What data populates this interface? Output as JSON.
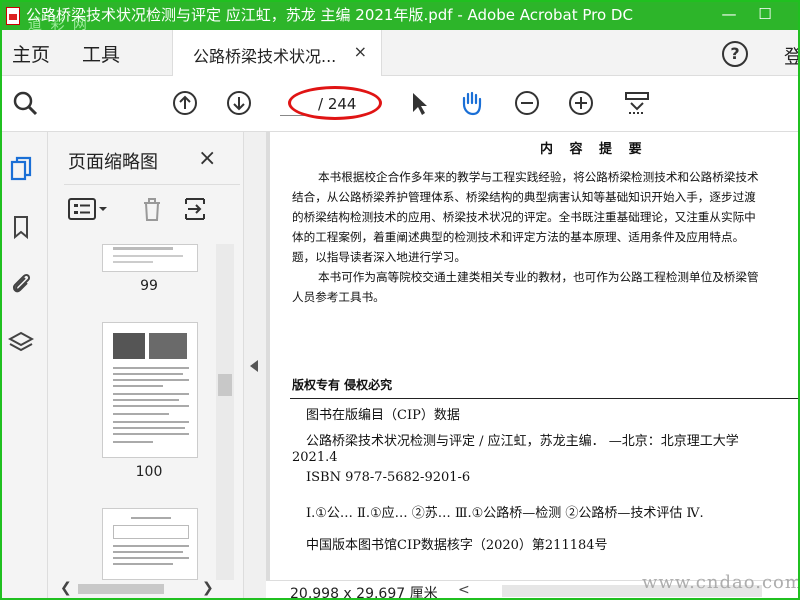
{
  "window": {
    "title": "公路桥梁技术状况检测与评定 应江虹，苏龙 主编 2021年版.pdf - Adobe Acrobat Pro DC",
    "title_watermark": "道 彩 网",
    "accent": "#2db52a"
  },
  "menu": {
    "home": "主页",
    "tools": "工具",
    "doc_tab": "公路桥梁技术状况...",
    "tab_close": "×",
    "help": "?",
    "sign": "登"
  },
  "toolbar": {
    "page_input_value": "",
    "page_total": "/ 244",
    "annotation_color": "#e01414"
  },
  "thumbnails": {
    "title": "页面缩略图",
    "close": "×",
    "pages": [
      "99",
      "100"
    ]
  },
  "document": {
    "heading": "内 容 提 要",
    "paragraphs": [
      "本书根据校企合作多年来的教学与工程实践经验，将公路桥梁检测技术和公路桥梁技术",
      "结合，从公路桥梁养护管理体系、桥梁结构的典型病害认知等基础知识开始入手，逐步过渡",
      "的桥梁结构检测技术的应用、桥梁技术状况的评定。全书既注重基础理论，又注重从实际中",
      "体的工程案例，着重阐述典型的检测技术和评定方法的基本原理、适用条件及应用特点。",
      "题，以指导读者深入地进行学习。",
      "本书可作为高等院校交通土建类相关专业的教材，也可作为公路工程检测单位及桥梁管",
      "人员参考工具书。"
    ],
    "copyright": "版权专有   侵权必究",
    "cip_title": "图书在版编目（CIP）数据",
    "cip_line1": "公路桥梁技术状况检测与评定 / 应江虹，苏龙主编． —北京：北京理工大学",
    "cip_line2": "2021.4",
    "isbn": "ISBN 978-7-5682-9201-6",
    "classification": "Ⅰ.①公… Ⅱ.①应… ②苏… Ⅲ.①公路桥—检测 ②公路桥—技术评估 Ⅳ.",
    "cip_number": "中国版本图书馆CIP数据核字（2020）第211184号"
  },
  "status": {
    "dimensions": "20.998 x 29.697 厘米",
    "scroll_left": "<"
  },
  "site_watermark": "www.cndao.com"
}
